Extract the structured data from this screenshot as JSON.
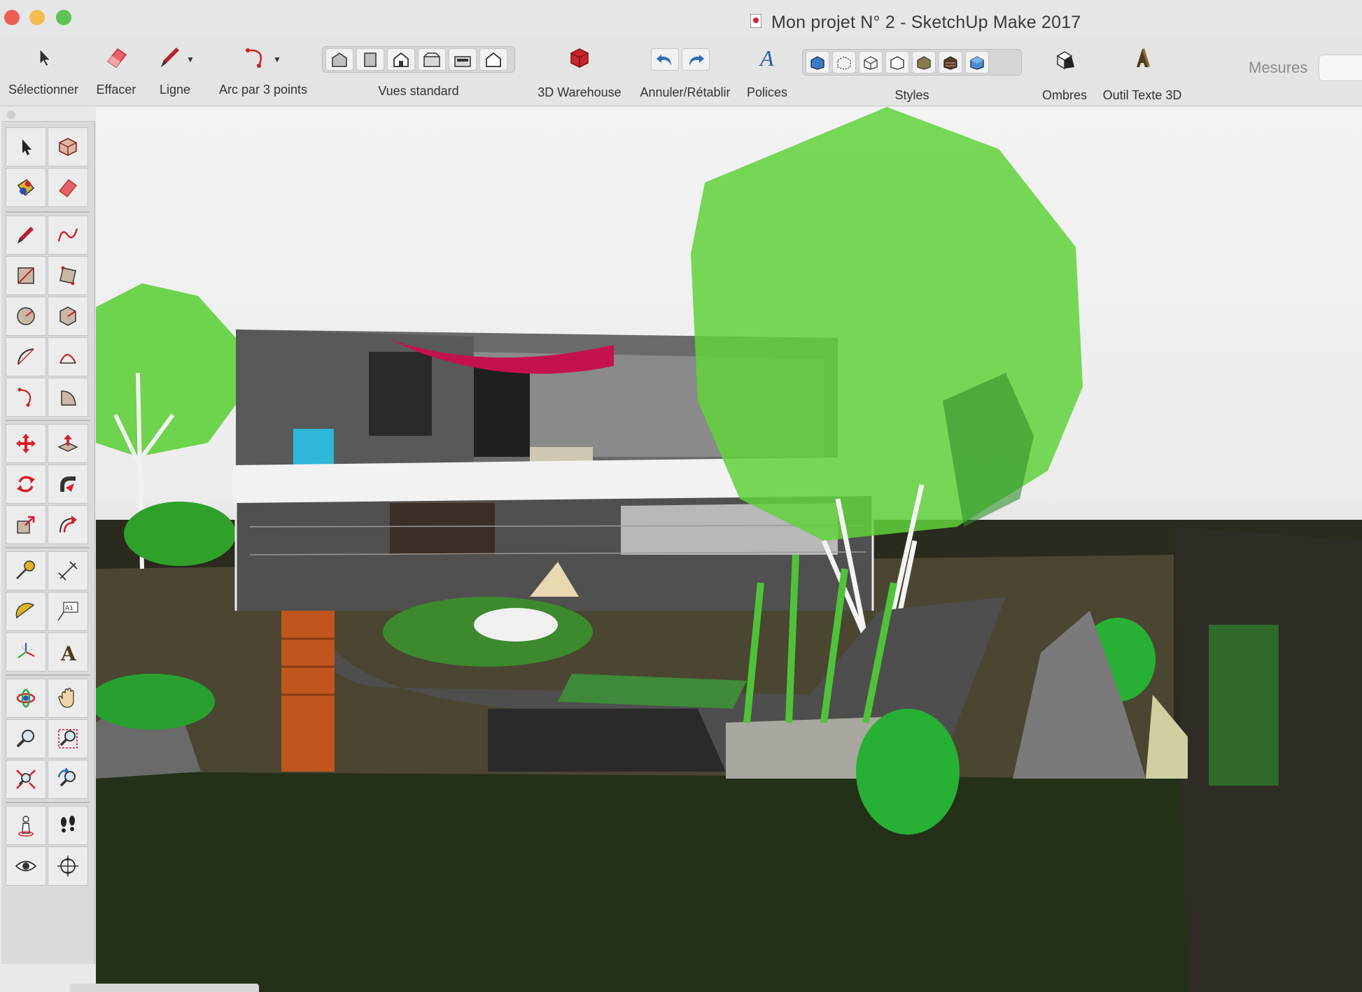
{
  "window": {
    "title": "Mon projet N° 2  - SketchUp Make 2017"
  },
  "toolbar": {
    "select_label": "Sélectionner",
    "eraser_label": "Effacer",
    "line_label": "Ligne",
    "arc_label": "Arc par 3 points",
    "standard_views_label": "Vues standard",
    "warehouse_label": "3D Warehouse",
    "undo_redo_label": "Annuler/Rétablir",
    "fonts_label": "Polices",
    "styles_label": "Styles",
    "shadows_label": "Ombres",
    "text3d_label": "Outil Texte 3D",
    "measures_label": "Mesures"
  },
  "palette": {
    "text_tool_glyph": "A1",
    "text3d_glyph": "A"
  },
  "colors": {
    "accent_red": "#d0262c",
    "tree_green": "#5fd23a",
    "canopy_red": "#c4124e",
    "style_blue": "#2a6fb8"
  }
}
